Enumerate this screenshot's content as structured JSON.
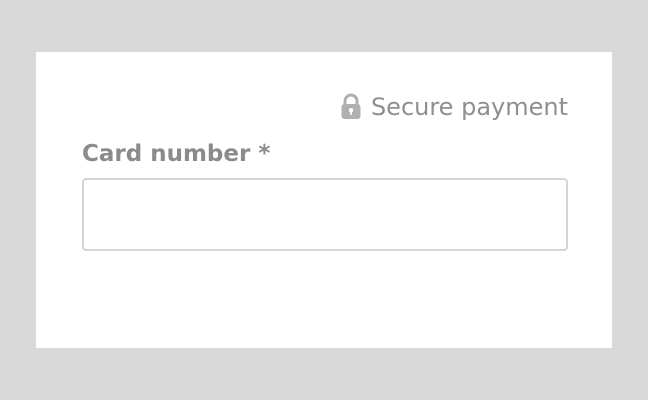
{
  "secure_badge": {
    "icon": "lock-icon",
    "text": "Secure payment"
  },
  "card_field": {
    "label": "Card number",
    "required_marker": "*",
    "value": "",
    "placeholder": ""
  },
  "colors": {
    "outer_background": "#d9d9d9",
    "card_background": "#ffffff",
    "muted_text": "#8f8f8f",
    "input_border": "#d5d5d5"
  }
}
